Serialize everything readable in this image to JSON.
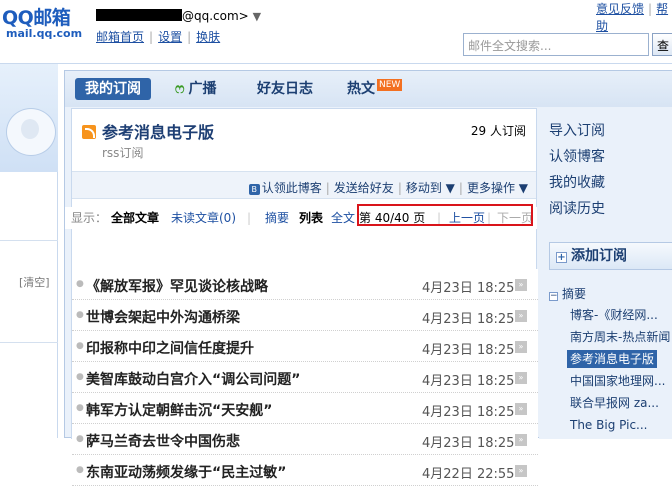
{
  "header": {
    "logo_main": "QQ邮箱",
    "logo_sub": "mail.qq.com",
    "account_suffix": "@qq.com>",
    "account_arrow": "▼",
    "links": [
      "邮箱首页",
      "设置",
      "换肤"
    ],
    "feedback": "意见反馈",
    "help": "帮助",
    "search_placeholder": "邮件全文搜索...",
    "search_button": "查"
  },
  "left": {
    "clear_label": "[清空]"
  },
  "tabs": [
    {
      "label": "我的订阅",
      "active": true
    },
    {
      "label": "广播",
      "icon": "broadcast-icon"
    },
    {
      "label": "好友日志"
    },
    {
      "label": "热文",
      "badge": "NEW"
    }
  ],
  "feed": {
    "title": "参考消息电子版",
    "subscribers": "29 人订阅",
    "type": "rss订阅",
    "actions": [
      "认领此博客",
      "发送给好友",
      "移动到 ▼",
      "更多操作 ▼"
    ],
    "filter": {
      "label": "显示：",
      "all": "全部文章",
      "unread": "未读文章(0)",
      "summary": "摘要",
      "list": "列表",
      "full": "全文",
      "page": "第 40/40 页",
      "prev": "上一页",
      "next": "下一页"
    },
    "articles": [
      {
        "title": "《解放军报》罕见谈论核战略",
        "date": "4月23日 18:25"
      },
      {
        "title": "世博会架起中外沟通桥梁",
        "date": "4月23日 18:25"
      },
      {
        "title": "印报称中印之间信任度提升",
        "date": "4月23日 18:25"
      },
      {
        "title": "美智库鼓动白宫介入“调公司问题”",
        "date": "4月23日 18:25"
      },
      {
        "title": "韩军方认定朝鲜击沉“天安舰”",
        "date": "4月23日 18:25"
      },
      {
        "title": "萨马兰奇去世令中国伤悲",
        "date": "4月23日 18:25"
      },
      {
        "title": "东南亚动荡频发缘于“民主过敏”",
        "date": "4月22日 22:55"
      }
    ]
  },
  "sidebar": {
    "links": [
      "导入订阅",
      "认领博客",
      "我的收藏",
      "阅读历史"
    ],
    "add_button": "添加订阅",
    "group": "摘要",
    "items": [
      {
        "label": "博客-《财经网..."
      },
      {
        "label": "南方周末-热点新闻"
      },
      {
        "label": "参考消息电子版",
        "selected": true
      },
      {
        "label": "中国国家地理网..."
      },
      {
        "label": "联合早报网 za..."
      },
      {
        "label": "The Big Pic..."
      }
    ]
  },
  "colors": {
    "accent": "#2f64a8",
    "highlight_border": "#d9141a",
    "new_badge": "#f37021"
  }
}
